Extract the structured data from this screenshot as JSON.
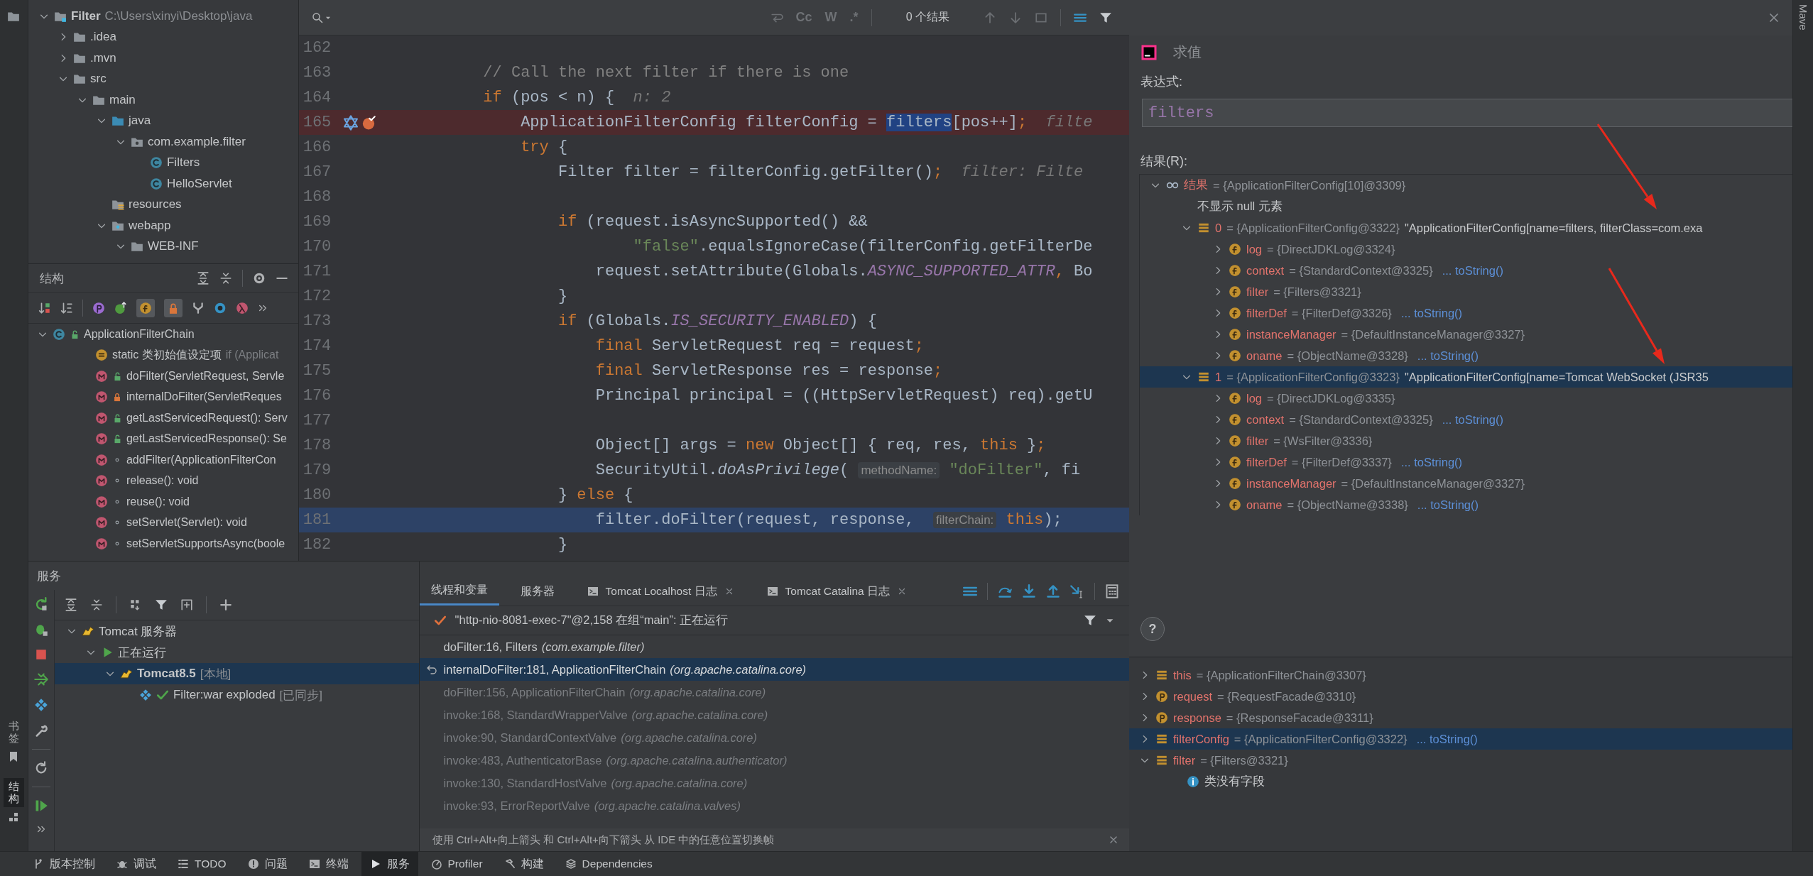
{
  "side_tabs": [
    {
      "label": "书签",
      "selected": false
    },
    {
      "label": "结构",
      "selected": true
    }
  ],
  "project": {
    "items": [
      {
        "kind": "module",
        "name": "Filter",
        "path": "C:\\Users\\xinyi\\Desktop\\java",
        "expanded": true,
        "children": [
          {
            "kind": "folder",
            "name": ".idea",
            "expanded": false
          },
          {
            "kind": "folder",
            "name": ".mvn",
            "expanded": false
          },
          {
            "kind": "folder",
            "name": "src",
            "expanded": true,
            "children": [
              {
                "kind": "folder",
                "name": "main",
                "expanded": true,
                "children": [
                  {
                    "kind": "source-folder",
                    "name": "java",
                    "expanded": true,
                    "children": [
                      {
                        "kind": "package",
                        "name": "com.example.filter",
                        "expanded": true,
                        "children": [
                          {
                            "kind": "class",
                            "name": "Filters"
                          },
                          {
                            "kind": "class",
                            "name": "HelloServlet"
                          }
                        ]
                      }
                    ]
                  },
                  {
                    "kind": "resources",
                    "name": "resources"
                  },
                  {
                    "kind": "web",
                    "name": "webapp",
                    "expanded": true,
                    "children": [
                      {
                        "kind": "folder",
                        "name": "WEB-INF",
                        "expanded": true
                      }
                    ]
                  }
                ]
              }
            ]
          }
        ]
      }
    ]
  },
  "structure": {
    "title": "结构",
    "items": [
      {
        "kind": "public-class",
        "name": "ApplicationFilterChain",
        "expanded": true,
        "children": [
          {
            "kind": "initializer",
            "name": "static 类初始值设定项",
            "hint": "if (Applicat"
          },
          {
            "kind": "public-method",
            "name": "doFilter(ServletRequest, Servle"
          },
          {
            "kind": "private-method",
            "name": "internalDoFilter(ServletReques"
          },
          {
            "kind": "public-method",
            "name": "getLastServicedRequest(): Serv"
          },
          {
            "kind": "public-method",
            "name": "getLastServicedResponse(): Se"
          },
          {
            "kind": "package-method",
            "name": "addFilter(ApplicationFilterCon"
          },
          {
            "kind": "package-method",
            "name": "release(): void"
          },
          {
            "kind": "package-method",
            "name": "reuse(): void"
          },
          {
            "kind": "package-method",
            "name": "setServlet(Servlet): void"
          },
          {
            "kind": "package-method",
            "name": "setServletSupportsAsync(boole"
          }
        ]
      }
    ]
  },
  "editor": {
    "search": {
      "options": [
        "Cc",
        "W",
        ".*"
      ],
      "result": "0 个结果"
    },
    "lines": [
      {
        "number": "162",
        "breakpoint": false,
        "current": false
      },
      {
        "number": "163",
        "breakpoint": false,
        "current": false,
        "segments": [
          {
            "text": "        // Call the next filter if there is one",
            "kind": "comment"
          }
        ]
      },
      {
        "number": "164",
        "breakpoint": false,
        "current": false,
        "segments": [
          {
            "text": "        if",
            "kind": "keyword"
          },
          {
            "text": " (pos < n) {  ",
            "kind": "plain"
          },
          {
            "text": "n: 2",
            "kind": "hint"
          }
        ]
      },
      {
        "number": "165",
        "breakpoint": true,
        "current": false,
        "segments": [
          {
            "text": "            ApplicationFilterConfig filterConfig = ",
            "kind": "plain"
          },
          {
            "text": "filters",
            "kind": "match"
          },
          {
            "text": "[pos++]",
            "kind": "plain"
          },
          {
            "text": ";",
            "kind": "keyword"
          },
          {
            "text": "  filte",
            "kind": "hint"
          }
        ]
      },
      {
        "number": "166",
        "breakpoint": false,
        "current": false,
        "segments": [
          {
            "text": "            try",
            "kind": "keyword"
          },
          {
            "text": " {",
            "kind": "plain"
          }
        ]
      },
      {
        "number": "167",
        "breakpoint": false,
        "current": false,
        "segments": [
          {
            "text": "                Filter filter = filterConfig.getFilter()",
            "kind": "plain"
          },
          {
            "text": ";",
            "kind": "keyword"
          },
          {
            "text": "  filter: Filte",
            "kind": "hint"
          }
        ]
      },
      {
        "number": "168",
        "breakpoint": false,
        "current": false
      },
      {
        "number": "169",
        "breakpoint": false,
        "current": false,
        "segments": [
          {
            "text": "                if",
            "kind": "keyword"
          },
          {
            "text": " (request.isAsyncSupported() &&",
            "kind": "plain"
          }
        ]
      },
      {
        "number": "170",
        "breakpoint": false,
        "current": false,
        "segments": [
          {
            "text": "                        \"false\"",
            "kind": "string"
          },
          {
            "text": ".equalsIgnoreCase(filterConfig.getFilterDe",
            "kind": "plain"
          }
        ]
      },
      {
        "number": "171",
        "breakpoint": false,
        "current": false,
        "segments": [
          {
            "text": "                    request.setAttribute(Globals.",
            "kind": "plain"
          },
          {
            "text": "ASYNC_SUPPORTED_ATTR",
            "kind": "constant"
          },
          {
            "text": ",",
            "kind": "keyword"
          },
          {
            "text": " Bo",
            "kind": "plain"
          }
        ]
      },
      {
        "number": "172",
        "breakpoint": false,
        "current": false,
        "segments": [
          {
            "text": "                }",
            "kind": "plain"
          }
        ]
      },
      {
        "number": "173",
        "breakpoint": false,
        "current": false,
        "segments": [
          {
            "text": "                if",
            "kind": "keyword"
          },
          {
            "text": " (Globals.",
            "kind": "plain"
          },
          {
            "text": "IS_SECURITY_ENABLED",
            "kind": "constant"
          },
          {
            "text": ") {",
            "kind": "plain"
          }
        ]
      },
      {
        "number": "174",
        "breakpoint": false,
        "current": false,
        "segments": [
          {
            "text": "                    final",
            "kind": "keyword"
          },
          {
            "text": " ServletRequest req = request",
            "kind": "plain"
          },
          {
            "text": ";",
            "kind": "keyword"
          }
        ]
      },
      {
        "number": "175",
        "breakpoint": false,
        "current": false,
        "segments": [
          {
            "text": "                    final",
            "kind": "keyword"
          },
          {
            "text": " ServletResponse res = response",
            "kind": "plain"
          },
          {
            "text": ";",
            "kind": "keyword"
          }
        ]
      },
      {
        "number": "176",
        "breakpoint": false,
        "current": false,
        "segments": [
          {
            "text": "                    Principal principal = ((HttpServletRequest) req).getU",
            "kind": "plain"
          }
        ]
      },
      {
        "number": "177",
        "breakpoint": false,
        "current": false
      },
      {
        "number": "178",
        "breakpoint": false,
        "current": false,
        "segments": [
          {
            "text": "                    Object[] args = ",
            "kind": "plain"
          },
          {
            "text": "new",
            "kind": "keyword"
          },
          {
            "text": " Object[] { req, res, ",
            "kind": "plain"
          },
          {
            "text": "this",
            "kind": "keyword"
          },
          {
            "text": " }",
            "kind": "plain"
          },
          {
            "text": ";",
            "kind": "keyword"
          }
        ]
      },
      {
        "number": "179",
        "breakpoint": false,
        "current": false,
        "segments": [
          {
            "text": "                    SecurityUtil.",
            "kind": "plain"
          },
          {
            "text": "doAsPrivilege",
            "kind": "italic"
          },
          {
            "text": "( ",
            "kind": "plain"
          },
          {
            "text": "methodName:",
            "kind": "inlay"
          },
          {
            "text": " \"doFilter\"",
            "kind": "string"
          },
          {
            "text": ", fi",
            "kind": "plain"
          }
        ]
      },
      {
        "number": "180",
        "breakpoint": false,
        "current": false,
        "segments": [
          {
            "text": "                } ",
            "kind": "plain"
          },
          {
            "text": "else",
            "kind": "keyword"
          },
          {
            "text": " {",
            "kind": "plain"
          }
        ]
      },
      {
        "number": "181",
        "breakpoint": false,
        "current": true,
        "segments": [
          {
            "text": "                    filter.doFilter(request, response,  ",
            "kind": "plain"
          },
          {
            "text": "filterChain:",
            "kind": "inlay"
          },
          {
            "text": " this",
            "kind": "keyword"
          },
          {
            "text": ");",
            "kind": "plain"
          }
        ]
      },
      {
        "number": "182",
        "breakpoint": false,
        "current": false,
        "segments": [
          {
            "text": "                }",
            "kind": "plain"
          }
        ]
      }
    ]
  },
  "evaluate": {
    "title": "求值",
    "expression_label": "表达式:",
    "expression": "filters",
    "result_label": "结果(R):",
    "result": [
      {
        "kind": "result",
        "name": "结果",
        "value": "= {ApplicationFilterConfig[10]@3309}",
        "expanded": true,
        "selected": false,
        "children": [
          {
            "kind": "note",
            "text": "不显示 null 元素"
          },
          {
            "kind": "item",
            "name": "0",
            "value": "= {ApplicationFilterConfig@3322}",
            "desc": "\"ApplicationFilterConfig[name=filters, filterClass=com.exa",
            "expanded": true,
            "selected": false,
            "children": [
              {
                "kind": "field",
                "name": "log",
                "value": "= {DirectJDKLog@3324}",
                "expanded": false,
                "selected": false
              },
              {
                "kind": "field",
                "name": "context",
                "value": "= {StandardContext@3325}",
                "link": "... toString()",
                "expanded": false,
                "selected": false
              },
              {
                "kind": "field",
                "name": "filter",
                "value": "= {Filters@3321}",
                "expanded": false,
                "selected": false
              },
              {
                "kind": "field",
                "name": "filterDef",
                "value": "= {FilterDef@3326}",
                "link": "... toString()",
                "expanded": false,
                "selected": false
              },
              {
                "kind": "field",
                "name": "instanceManager",
                "value": "= {DefaultInstanceManager@3327}",
                "expanded": false,
                "selected": false
              },
              {
                "kind": "field",
                "name": "oname",
                "value": "= {ObjectName@3328}",
                "link": "... toString()",
                "expanded": false,
                "selected": false
              }
            ]
          },
          {
            "kind": "item",
            "name": "1",
            "value": "= {ApplicationFilterConfig@3323}",
            "desc": "\"ApplicationFilterConfig[name=Tomcat WebSocket (JSR35",
            "expanded": true,
            "selected": true,
            "children": [
              {
                "kind": "field",
                "name": "log",
                "value": "= {DirectJDKLog@3335}",
                "expanded": false,
                "selected": false
              },
              {
                "kind": "field",
                "name": "context",
                "value": "= {StandardContext@3325}",
                "link": "... toString()",
                "expanded": false,
                "selected": false
              },
              {
                "kind": "field",
                "name": "filter",
                "value": "= {WsFilter@3336}",
                "expanded": false,
                "selected": false
              },
              {
                "kind": "field",
                "name": "filterDef",
                "value": "= {FilterDef@3337}",
                "link": "... toString()",
                "expanded": false,
                "selected": false
              },
              {
                "kind": "field",
                "name": "instanceManager",
                "value": "= {DefaultInstanceManager@3327}",
                "expanded": false,
                "selected": false
              },
              {
                "kind": "field",
                "name": "oname",
                "value": "= {ObjectName@3338}",
                "link": "... toString()",
                "expanded": false,
                "selected": false
              }
            ]
          }
        ]
      }
    ],
    "help": "?"
  },
  "maven_tab": "Mave",
  "variables": [
    {
      "kind": "local",
      "name": "this",
      "value": "= {ApplicationFilterChain@3307}",
      "expanded": false,
      "selected": false
    },
    {
      "kind": "param",
      "name": "request",
      "value": "= {RequestFacade@3310}",
      "expanded": false,
      "selected": false
    },
    {
      "kind": "param",
      "name": "response",
      "value": "= {ResponseFacade@3311}",
      "expanded": false,
      "selected": false
    },
    {
      "kind": "local",
      "name": "filterConfig",
      "value": "= {ApplicationFilterConfig@3322}",
      "link": "... toString()",
      "expanded": false,
      "selected": true
    },
    {
      "kind": "local",
      "name": "filter",
      "value": "= {Filters@3321}",
      "expanded": true,
      "selected": false,
      "children": [
        {
          "kind": "info",
          "text": "类没有字段"
        }
      ]
    }
  ],
  "services": {
    "title": "服务",
    "items": [
      {
        "kind": "server-group",
        "name": "Tomcat 服务器",
        "expanded": true,
        "selected": false,
        "children": [
          {
            "kind": "running",
            "name": "正在运行",
            "expanded": true,
            "selected": false,
            "children": [
              {
                "kind": "server",
                "name": "Tomcat8.5",
                "tag": "[本地]",
                "expanded": true,
                "selected": true,
                "children": [
                  {
                    "kind": "artifact",
                    "name": "Filter:war exploded",
                    "tag": "[已同步]",
                    "selected": false
                  }
                ]
              }
            ]
          }
        ]
      }
    ]
  },
  "debugger": {
    "tabs": [
      {
        "label": "线程和变量",
        "kind": "plain",
        "closable": false,
        "selected": true
      },
      {
        "label": "服务器",
        "kind": "plain",
        "closable": false,
        "selected": false
      },
      {
        "label": "Tomcat Localhost 日志",
        "kind": "log",
        "closable": true,
        "selected": false
      },
      {
        "label": "Tomcat Catalina 日志",
        "kind": "log",
        "closable": true,
        "selected": false
      }
    ],
    "thread": "\"http-nio-8081-exec-7\"@2,158 在组“main”: 正在运行",
    "frames": [
      {
        "method": "doFilter:16, Filters",
        "package": "(com.example.filter)",
        "kind": "user",
        "selected": false
      },
      {
        "method": "internalDoFilter:181, ApplicationFilterChain",
        "package": "(org.apache.catalina.core)",
        "kind": "user",
        "selected": true
      },
      {
        "method": "doFilter:156, ApplicationFilterChain",
        "package": "(org.apache.catalina.core)",
        "kind": "library",
        "selected": false
      },
      {
        "method": "invoke:168, StandardWrapperValve",
        "package": "(org.apache.catalina.core)",
        "kind": "library",
        "selected": false
      },
      {
        "method": "invoke:90, StandardContextValve",
        "package": "(org.apache.catalina.core)",
        "kind": "library",
        "selected": false
      },
      {
        "method": "invoke:483, AuthenticatorBase",
        "package": "(org.apache.catalina.authenticator)",
        "kind": "library",
        "selected": false
      },
      {
        "method": "invoke:130, StandardHostValve",
        "package": "(org.apache.catalina.core)",
        "kind": "library",
        "selected": false
      },
      {
        "method": "invoke:93, ErrorReportValve",
        "package": "(org.apache.catalina.valves)",
        "kind": "library",
        "selected": false
      }
    ],
    "hint": "使用 Ctrl+Alt+向上箭头 和 Ctrl+Alt+向下箭头 从 IDE 中的任意位置切换帧"
  },
  "tool_bar": [
    {
      "kind": "vcs",
      "label": "版本控制",
      "selected": false
    },
    {
      "kind": "debug",
      "label": "调试",
      "selected": false
    },
    {
      "kind": "todo",
      "label": "TODO",
      "selected": false
    },
    {
      "kind": "problems",
      "label": "问题",
      "selected": false
    },
    {
      "kind": "terminal",
      "label": "终端",
      "selected": false
    },
    {
      "kind": "services",
      "label": "服务",
      "selected": true
    },
    {
      "kind": "profiler",
      "label": "Profiler",
      "selected": false
    },
    {
      "kind": "build",
      "label": "构建",
      "selected": false
    },
    {
      "kind": "dependencies",
      "label": "Dependencies",
      "selected": false
    }
  ]
}
